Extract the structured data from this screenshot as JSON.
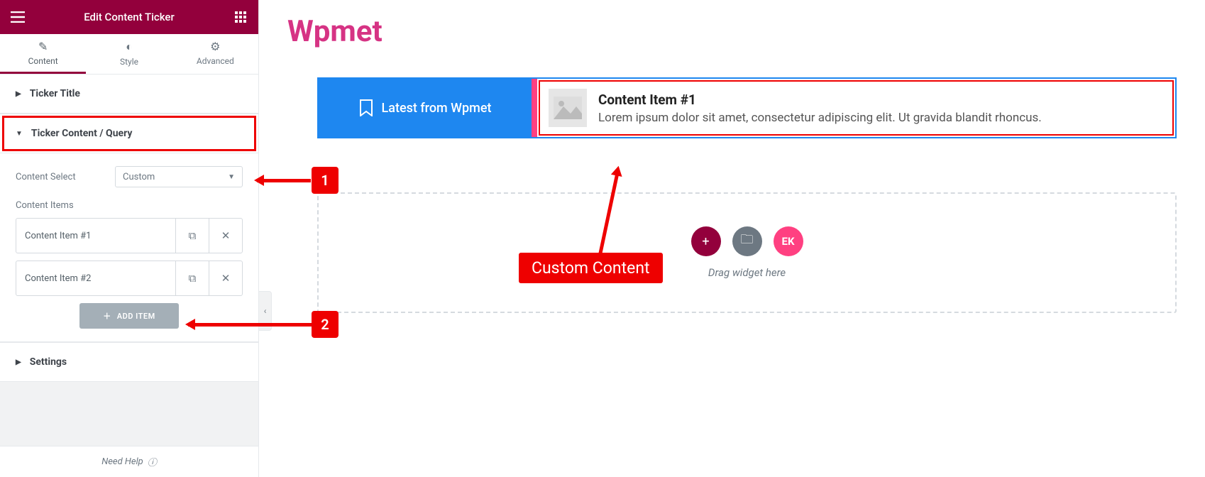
{
  "panel": {
    "title": "Edit Content Ticker",
    "tabs": {
      "content": "Content",
      "style": "Style",
      "advanced": "Advanced"
    },
    "sections": {
      "ticker_title": "Ticker Title",
      "ticker_content": "Ticker Content / Query",
      "settings": "Settings"
    },
    "content_select_label": "Content Select",
    "content_select_value": "Custom",
    "content_items_label": "Content Items",
    "items": [
      {
        "title": "Content Item #1"
      },
      {
        "title": "Content Item #2"
      }
    ],
    "add_item": "ADD ITEM",
    "need_help": "Need Help"
  },
  "canvas": {
    "logo": "Wpmet",
    "ticker_label": "Latest from Wpmet",
    "item_title": "Content Item #1",
    "item_text": "Lorem ipsum dolor sit amet, consectetur adipiscing elit. Ut gravida blandit rhoncus.",
    "drag_hint": "Drag widget here",
    "ek_label": "EK"
  },
  "annotations": {
    "one": "1",
    "two": "2",
    "custom_content": "Custom Content"
  }
}
